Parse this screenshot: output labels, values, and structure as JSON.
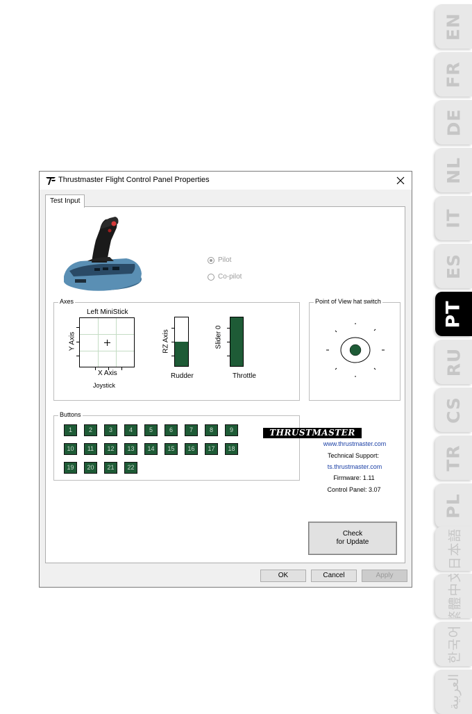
{
  "languages": [
    {
      "label": "EN"
    },
    {
      "label": "FR"
    },
    {
      "label": "DE"
    },
    {
      "label": "NL"
    },
    {
      "label": "IT"
    },
    {
      "label": "ES"
    },
    {
      "label": "PT"
    },
    {
      "label": "RU"
    },
    {
      "label": "CS"
    },
    {
      "label": "TR"
    },
    {
      "label": "PL"
    },
    {
      "label": "日本語"
    },
    {
      "label": "繁體中文"
    },
    {
      "label": "한국어"
    },
    {
      "label": "العربية"
    }
  ],
  "active_language": "PT",
  "dialog": {
    "title": "Thrustmaster Flight Control Panel Properties",
    "close_icon": "close-icon",
    "tab": "Test Input"
  },
  "mode": {
    "pilot_label": "Pilot",
    "copilot_label": "Co-pilot",
    "selected": "Pilot"
  },
  "axes": {
    "group_title": "Axes",
    "ministick_title": "Left MiniStick",
    "y_axis_label": "Y Axis",
    "x_axis_label": "X Axis",
    "joystick_label": "Joystick",
    "rz_axis_label": "RZ Axis",
    "rudder_label": "Rudder",
    "rudder_level": 0.5,
    "slider_label": "Slider 0",
    "throttle_label": "Throttle",
    "throttle_level": 1.0
  },
  "pov": {
    "group_title": "Point of View hat switch"
  },
  "buttons": {
    "group_title": "Buttons",
    "labels": [
      "1",
      "2",
      "3",
      "4",
      "5",
      "6",
      "7",
      "8",
      "9",
      "10",
      "11",
      "12",
      "13",
      "14",
      "15",
      "16",
      "17",
      "18",
      "19",
      "20",
      "21",
      "22"
    ]
  },
  "info": {
    "brand": "THRUSTMASTER",
    "website": "www.thrustmaster.com",
    "support_label": "Technical Support:",
    "support_url": "ts.thrustmaster.com",
    "firmware": "Firmware:  1.11",
    "control_panel": "Control Panel:  3.07"
  },
  "actions": {
    "check_line1": "Check",
    "check_line2": "for Update",
    "ok": "OK",
    "cancel": "Cancel",
    "apply": "Apply"
  },
  "colors": {
    "active_green": "#1e5b36",
    "link_blue": "#1a3fa5"
  }
}
